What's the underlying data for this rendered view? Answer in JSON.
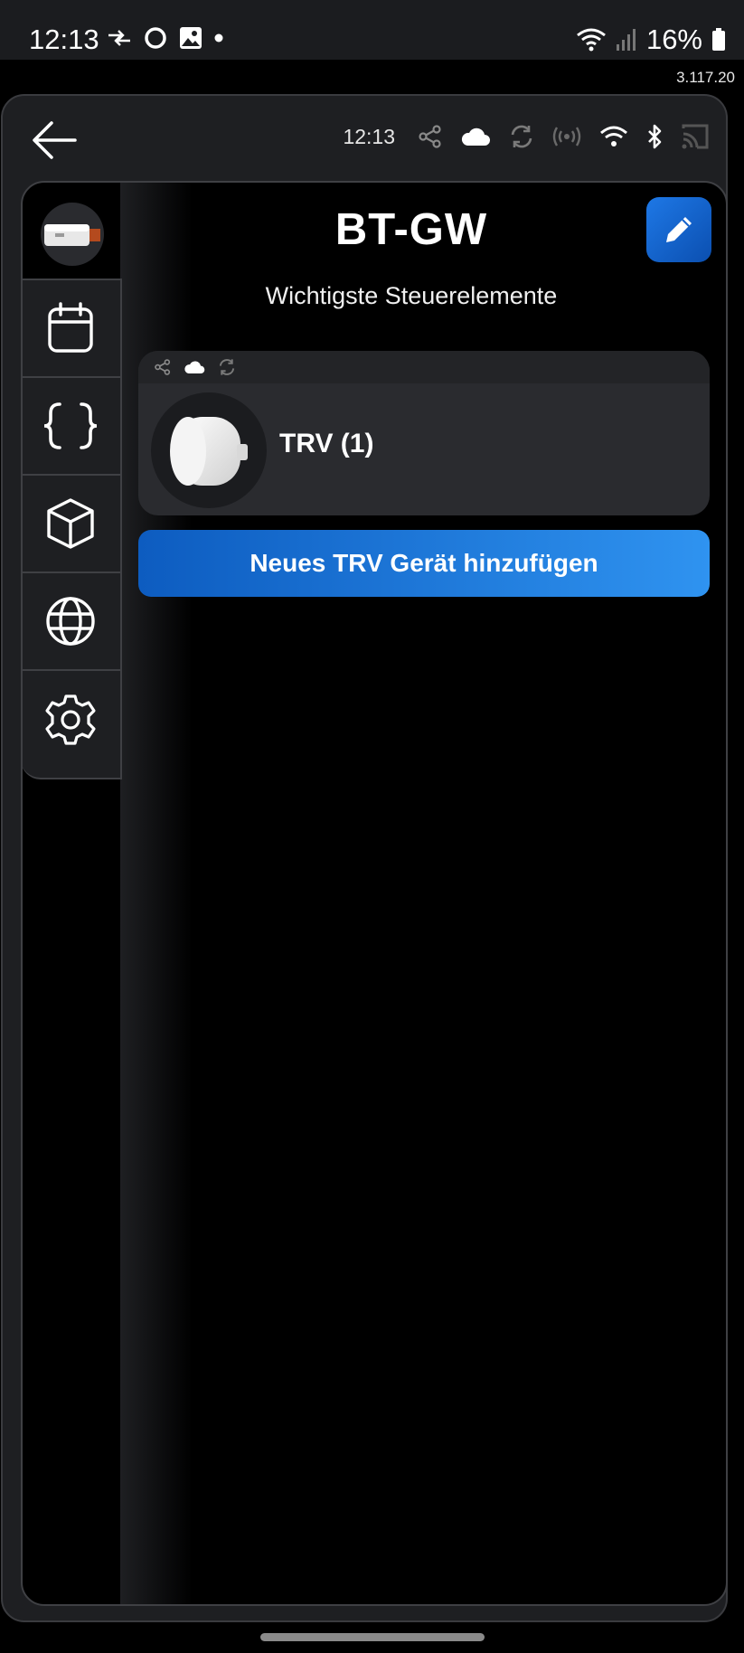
{
  "status_bar": {
    "time": "12:13",
    "battery": "16%"
  },
  "version": "3.117.20",
  "header": {
    "time": "12:13"
  },
  "page": {
    "title": "BT-GW",
    "subtitle": "Wichtigste Steuerelemente"
  },
  "device_card": {
    "label": "TRV (1)"
  },
  "add_button": {
    "label": "Neues TRV Gerät hinzufügen"
  },
  "sidebar": {
    "items": [
      "calendar-icon",
      "code-braces-icon",
      "cube-icon",
      "globe-icon",
      "gear-icon"
    ]
  },
  "colors": {
    "accent": "#1e78e6",
    "background": "#000000",
    "panel": "#1e1f22"
  }
}
